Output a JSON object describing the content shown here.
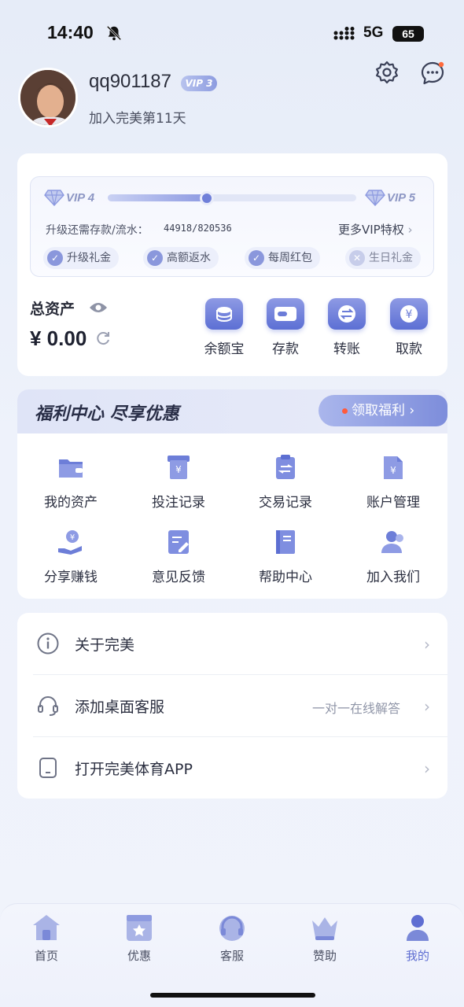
{
  "status_bar": {
    "time": "14:40",
    "network": "5G",
    "battery": "65"
  },
  "profile": {
    "username": "qq901187",
    "vip_badge": "VIP 3",
    "join_text": "加入完美第11天"
  },
  "vip": {
    "current_level": "VIP 4",
    "next_level": "VIP 5",
    "progress": 0.4,
    "upgrade_label": "升级还需存款/流水：",
    "upgrade_value": "44918/820536",
    "more_link": "更多VIP特权",
    "perks": [
      {
        "label": "升级礼金",
        "enabled": true
      },
      {
        "label": "高额返水",
        "enabled": true
      },
      {
        "label": "每周红包",
        "enabled": true
      },
      {
        "label": "生日礼金",
        "enabled": false
      }
    ]
  },
  "assets": {
    "label": "总资产",
    "amount": "¥ 0.00",
    "actions": [
      {
        "label": "余额宝",
        "icon": "coin-stack-icon"
      },
      {
        "label": "存款",
        "icon": "wallet-icon"
      },
      {
        "label": "转账",
        "icon": "transfer-icon"
      },
      {
        "label": "取款",
        "icon": "withdraw-icon"
      }
    ]
  },
  "welfare": {
    "title": "福利中心  尽享优惠",
    "claim_label": "领取福利",
    "items": [
      {
        "label": "我的资产",
        "icon": "folder-icon"
      },
      {
        "label": "投注记录",
        "icon": "bet-record-icon"
      },
      {
        "label": "交易记录",
        "icon": "clipboard-icon"
      },
      {
        "label": "账户管理",
        "icon": "account-file-icon"
      },
      {
        "label": "分享赚钱",
        "icon": "hand-coin-icon"
      },
      {
        "label": "意见反馈",
        "icon": "feedback-icon"
      },
      {
        "label": "帮助中心",
        "icon": "help-book-icon"
      },
      {
        "label": "加入我们",
        "icon": "people-icon"
      }
    ]
  },
  "menu": [
    {
      "label": "关于完美",
      "sub": "",
      "icon": "info-icon"
    },
    {
      "label": "添加桌面客服",
      "sub": "一对一在线解答",
      "icon": "headset-icon"
    },
    {
      "label": "打开完美体育APP",
      "sub": "",
      "icon": "phone-icon"
    }
  ],
  "tabs": [
    {
      "label": "首页",
      "icon": "home-icon",
      "active": false
    },
    {
      "label": "优惠",
      "icon": "gift-icon",
      "active": false
    },
    {
      "label": "客服",
      "icon": "headset-icon",
      "active": false
    },
    {
      "label": "赞助",
      "icon": "crown-icon",
      "active": false
    },
    {
      "label": "我的",
      "icon": "user-icon",
      "active": true
    }
  ],
  "colors": {
    "accent": "#6f7fd9",
    "background": "#e9eef9"
  }
}
